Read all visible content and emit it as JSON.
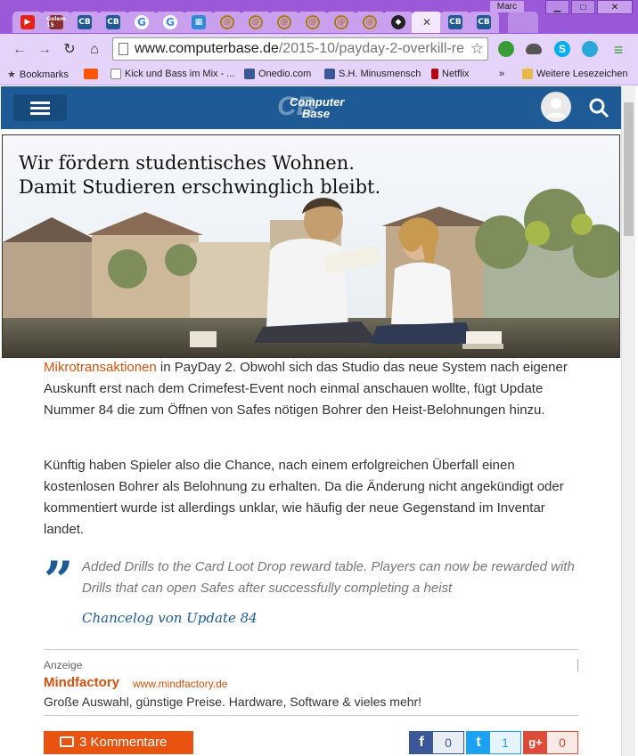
{
  "window": {
    "user_name": "Marc",
    "minimize": "▁",
    "maximize": "□",
    "close": "✕"
  },
  "tabs": [
    {
      "icon": "youtube-icon"
    },
    {
      "icon": "golem-icon",
      "label": "Golem 15"
    },
    {
      "icon": "computerbase-icon",
      "label": "CB"
    },
    {
      "icon": "computerbase-icon",
      "label": "CB"
    },
    {
      "icon": "google-icon",
      "label": "G"
    },
    {
      "icon": "google-icon",
      "label": "G"
    },
    {
      "icon": "news-icon"
    },
    {
      "icon": "steam-icon"
    },
    {
      "icon": "steam-icon"
    },
    {
      "icon": "steam-icon"
    },
    {
      "icon": "steam-icon"
    },
    {
      "icon": "steam-icon"
    },
    {
      "icon": "dark-icon"
    },
    {
      "icon": "computerbase-icon",
      "label": "CB",
      "active": true,
      "close": "✕"
    },
    {
      "icon": "computerbase-icon",
      "label": "CB"
    },
    {
      "icon": "computerbase-icon",
      "label": "CB"
    }
  ],
  "toolbar": {
    "url_domain": "www.computerbase.de",
    "url_path": "/2015-10/payday-2-overkill-re"
  },
  "bookmarks": {
    "items": [
      {
        "label": "Bookmarks",
        "icon": "star-icon"
      },
      {
        "label": "",
        "icon": "soundcloud-icon"
      },
      {
        "label": "Kick und Bass im Mix - ...",
        "icon": "page-icon"
      },
      {
        "label": "Onedio.com",
        "icon": "facebook-icon"
      },
      {
        "label": "S.H. Minusmensch",
        "icon": "facebook-icon"
      },
      {
        "label": "Netflix",
        "icon": "netflix-icon"
      }
    ],
    "more": "»",
    "other": "Weitere Lesezeichen"
  },
  "site": {
    "logo_line1": "Computer",
    "logo_line2": "Base",
    "logo_mark": "CB"
  },
  "banner": {
    "line1": "Wir fördern studentisches Wohnen.",
    "line2": "Damit Studieren erschwinglich bleibt."
  },
  "article": {
    "p1_link": "Mikrotransaktionen",
    "p1_rest": " in PayDay 2. Obwohl sich das Studio das neue System nach eigener Auskunft erst nach dem Crimefest-Event noch einmal anschauen wollte, fügt Update Nummer 84 die zum Öffnen von Safes nötigen Bohrer den Heist-Belohnungen hinzu.",
    "p2": "Künftig haben Spieler also die Chance, nach einem erfolgreichen Überfall einen kostenlosen Bohrer als Belohnung zu erhalten. Da die Änderung nicht angekündigt oder kommentiert wurde ist allerdings unklar, wie häufig der neue Gegenstand im Inventar landet.",
    "quote": "Added Drills to the Card Loot Drop reward table. Players can now be rewarded with Drills that can open Safes after successfully completing a heist",
    "quote_source": "Chancelog von Update 84"
  },
  "ad": {
    "label": "Anzeige",
    "name": "Mindfactory",
    "url": "www.mindfactory.de",
    "slogan": "Große Auswahl, günstige Preise. Hardware, Software & vieles mehr!"
  },
  "footer": {
    "comments": "3 Kommentare",
    "facebook_count": "0",
    "twitter_count": "1",
    "googleplus_count": "0",
    "facebook_glyph": "f",
    "twitter_glyph": "t",
    "googleplus_glyph": "g+"
  },
  "colors": {
    "chrome_frame": "#9b59d9",
    "site_blue": "#1e5a96",
    "accent_orange": "#e8540f",
    "facebook": "#3b5998",
    "twitter": "#1da1f2",
    "googleplus": "#dd4b39"
  }
}
